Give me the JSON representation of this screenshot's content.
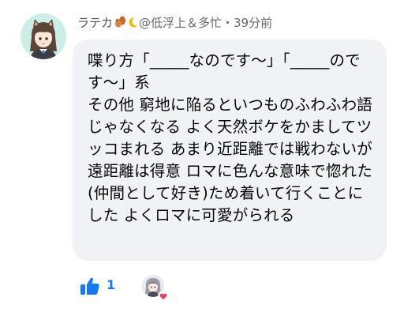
{
  "comment": {
    "author": "ラテカ",
    "author_emojis": [
      "squirrel-emoji",
      "crescent-moon-emoji"
    ],
    "status_line": "@低浮上＆多忙・39分前",
    "body": "喋り方「_____なのです〜」「_____のです〜」系\nその他 窮地に陥るといつものふわふわ語じゃなくなる よく天然ボケをかましてツッコまれる あまり近距離では戦わないが遠距離は得意 ロマに色んな意味で惚れた(仲間として好き)ため着いて行くことにした よくロマに可愛がられる"
  },
  "reactions": {
    "like_count": "1",
    "like_icon": "thumbs-up-icon",
    "reactor_badge": "heart-icon"
  },
  "colors": {
    "bubble_bg": "#f0f2f5",
    "like_blue": "#1877f2",
    "heart_red": "#e9405a"
  }
}
